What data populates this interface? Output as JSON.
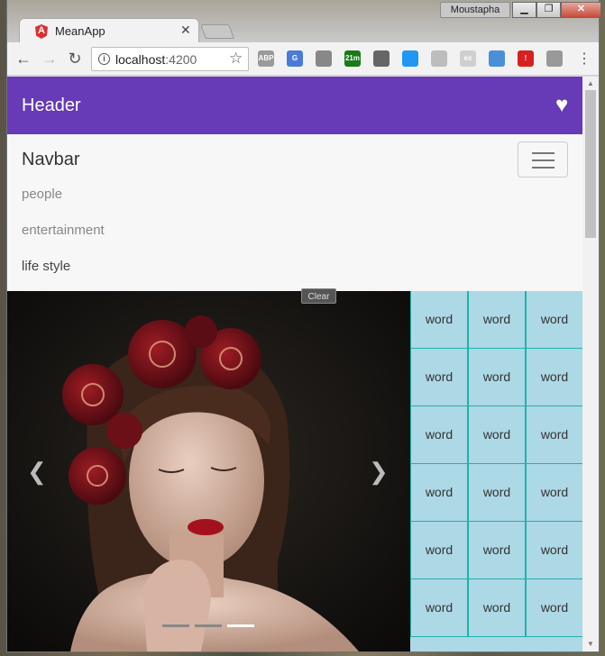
{
  "window": {
    "user": "Moustapha",
    "controls": [
      "minimize",
      "maximize",
      "close"
    ]
  },
  "tab": {
    "title": "MeanApp",
    "icon": "angular-icon"
  },
  "toolbar": {
    "url_host": "localhost",
    "url_port": ":4200",
    "extensions": [
      {
        "name": "abp-icon",
        "label": "ABP",
        "color": "#9a9a9a"
      },
      {
        "name": "translate-icon",
        "label": "G",
        "color": "#4a7bd8"
      },
      {
        "name": "extension-icon",
        "label": "",
        "color": "#888888"
      },
      {
        "name": "timer-icon",
        "label": "21m",
        "color": "#1a7a1a"
      },
      {
        "name": "bulb-icon",
        "label": "",
        "color": "#666666"
      },
      {
        "name": "screen-icon",
        "label": "",
        "color": "#2196f3"
      },
      {
        "name": "moon-icon",
        "label": "",
        "color": "#bdbdbd"
      },
      {
        "name": "ex-icon",
        "label": "ex",
        "color": "#cfcfcf"
      },
      {
        "name": "ring-icon",
        "label": "",
        "color": "#4a8fd8"
      },
      {
        "name": "stop-icon",
        "label": "!",
        "color": "#d82020"
      },
      {
        "name": "shield-icon",
        "label": "",
        "color": "#999999"
      }
    ]
  },
  "header": {
    "title": "Header"
  },
  "navbar": {
    "brand": "Navbar",
    "links": [
      "people",
      "entertainment",
      "life style"
    ]
  },
  "tooltip": {
    "label": "Clear"
  },
  "carousel": {
    "slides": 3,
    "active_slide": 3
  },
  "grid": {
    "rows": [
      [
        "word",
        "word",
        "word"
      ],
      [
        "word",
        "word",
        "word"
      ],
      [
        "word",
        "word",
        "word"
      ],
      [
        "word",
        "word",
        "word"
      ],
      [
        "word",
        "word",
        "word"
      ],
      [
        "word",
        "word",
        "word"
      ]
    ]
  },
  "colors": {
    "header_bg": "#673ab7",
    "grid_bg": "#add8e6",
    "grid_border": "#20b2aa"
  }
}
